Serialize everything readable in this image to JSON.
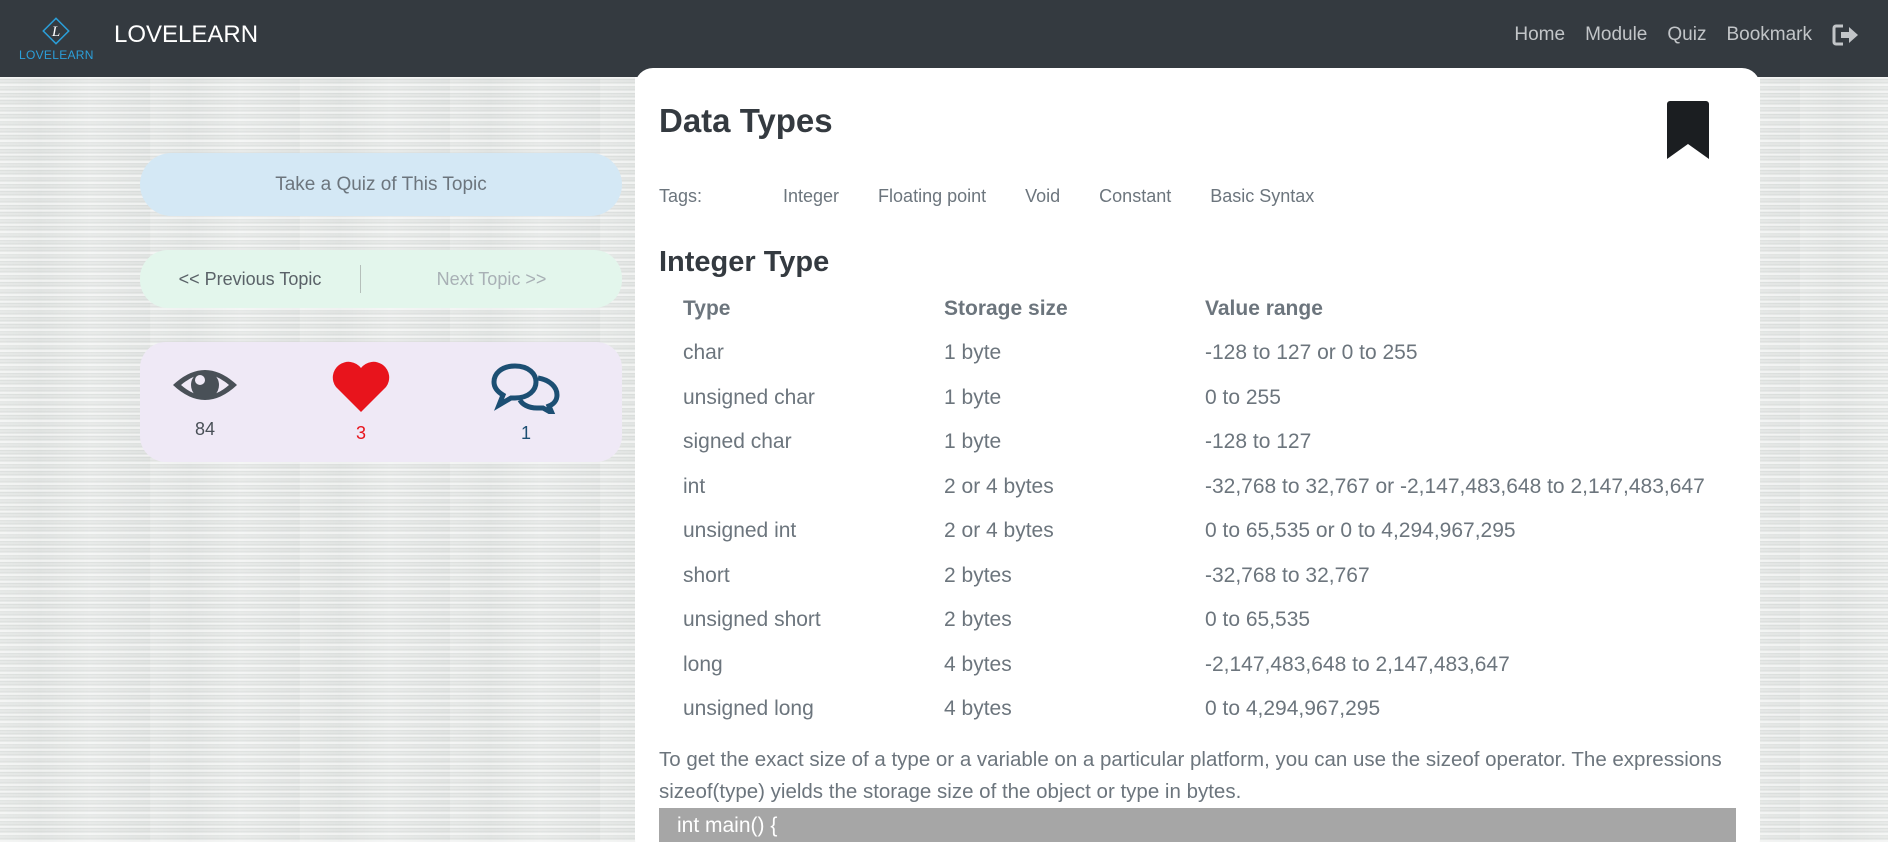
{
  "navbar": {
    "logo_text": "LOVELEARN",
    "brand": "LOVELEARN",
    "links": [
      "Home",
      "Module",
      "Quiz",
      "Bookmark"
    ],
    "logout_icon": "sign-out-icon",
    "background": "#343a40"
  },
  "sidebar": {
    "quiz_button": "Take a Quiz of This Topic",
    "prev_topic": "<< Previous Topic",
    "next_topic": "Next Topic >>",
    "stats": {
      "views": "84",
      "likes": "3",
      "comments": "1"
    },
    "icons": [
      "eye-icon",
      "heart-icon",
      "comments-icon"
    ]
  },
  "content": {
    "title": "Data Types",
    "tags_label": "Tags:",
    "tags": [
      "Integer",
      "Floating point",
      "Void",
      "Constant",
      "Basic Syntax"
    ],
    "section_title": "Integer Type",
    "table": {
      "headers": [
        "Type",
        "Storage size",
        "Value range"
      ],
      "rows": [
        [
          "char",
          "1 byte",
          "-128 to 127 or 0 to 255"
        ],
        [
          "unsigned char",
          "1 byte",
          "0 to 255"
        ],
        [
          "signed char",
          "1 byte",
          "-128 to 127"
        ],
        [
          "int",
          "2 or 4 bytes",
          "-32,768 to 32,767 or -2,147,483,648 to 2,147,483,647"
        ],
        [
          "unsigned int",
          "2 or 4 bytes",
          "0 to 65,535 or 0 to 4,294,967,295"
        ],
        [
          "short",
          "2 bytes",
          "-32,768 to 32,767"
        ],
        [
          "unsigned short",
          "2 bytes",
          "0 to 65,535"
        ],
        [
          "long",
          "4 bytes",
          "-2,147,483,648 to 2,147,483,647"
        ],
        [
          "unsigned long",
          "4 bytes",
          "0 to 4,294,967,295"
        ]
      ]
    },
    "paragraph": "To get the exact size of a type or a variable on a particular platform, you can use the sizeof operator. The expressions sizeof(type) yields the storage size of the object or type in bytes.",
    "code_first_line": "int main() {"
  },
  "colors": {
    "like_red": "#e8141c",
    "comment_blue": "#1c4f73",
    "eye_gray": "#495057"
  }
}
